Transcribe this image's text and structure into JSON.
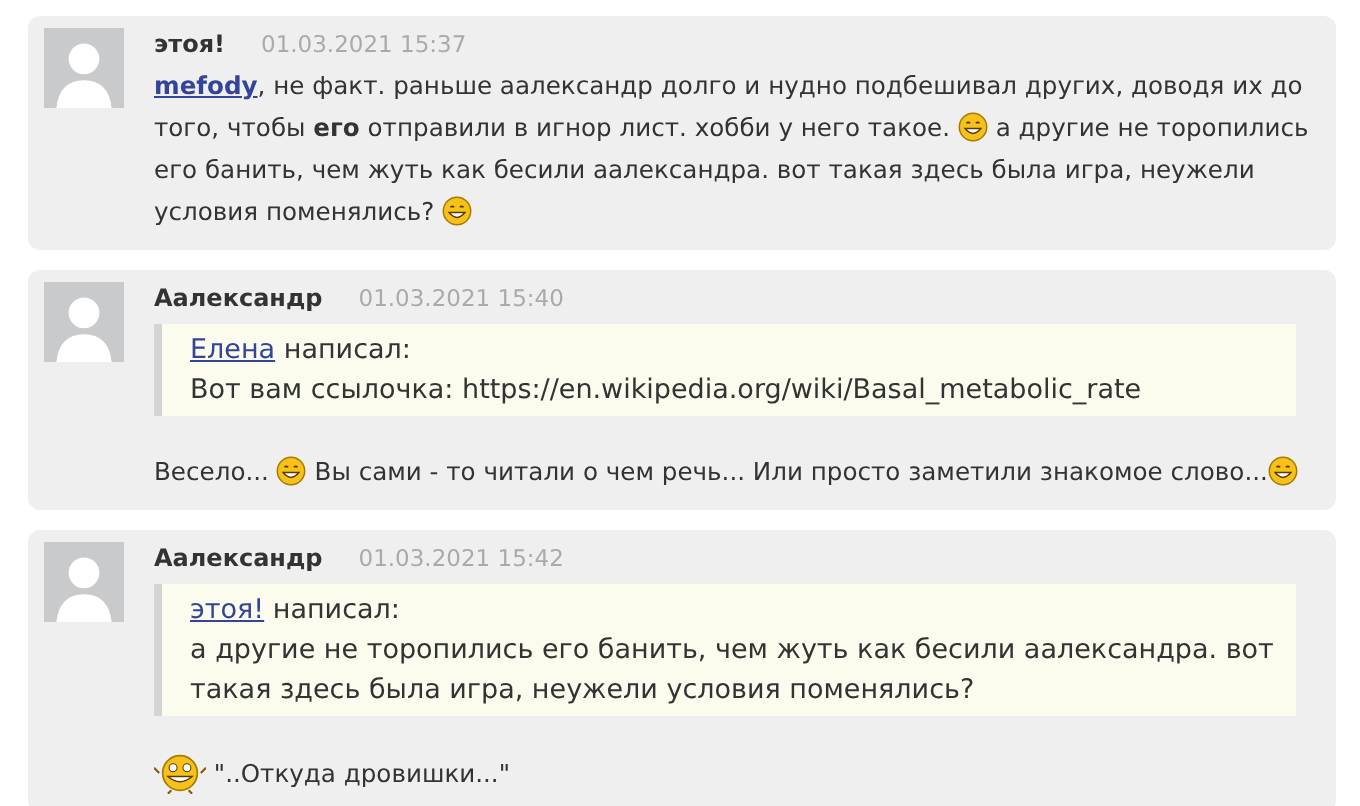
{
  "posts": [
    {
      "author": "этоя!",
      "time": "01.03.2021 15:37",
      "paragraphs": [
        [
          {
            "kind": "link",
            "text": "mefody"
          },
          {
            "kind": "text",
            "text": ", не факт. раньше аалександр долго и нудно подбешивал других, доводя их до того, чтобы **его** отправили в игнор лист. хобби у него такое. "
          },
          {
            "kind": "smiley"
          },
          {
            "kind": "text",
            "text": " а другие не торопились его банить, чем жуть как бесили аалександра. вот такая здесь была игра, неужели условия поменялись? "
          },
          {
            "kind": "smiley"
          }
        ]
      ]
    },
    {
      "author": "Аалександр",
      "time": "01.03.2021 15:40",
      "quote": {
        "author": "Елена",
        "verb": "написал:",
        "text": "Вот вам ссылочка: https://en.wikipedia.org/wiki/Basal_metabolic_rate"
      },
      "paragraphs": [
        [
          {
            "kind": "text",
            "text": "Весело... "
          },
          {
            "kind": "smiley"
          },
          {
            "kind": "text",
            "text": " Вы сами - то читали о чем речь... Или просто заметили знакомое слово..."
          },
          {
            "kind": "smiley"
          }
        ]
      ]
    },
    {
      "author": "Аалександр",
      "time": "01.03.2021 15:42",
      "quote": {
        "author": "этоя!",
        "verb": "написал:",
        "text": "а другие не торопились его банить, чем жуть как бесили аалександра. вот такая здесь была игра, неужели условия поменялись?"
      },
      "paragraphs": [
        [
          {
            "kind": "big-smiley"
          },
          {
            "kind": "text",
            "text": " \"..Откуда дровишки...\""
          }
        ]
      ]
    }
  ]
}
